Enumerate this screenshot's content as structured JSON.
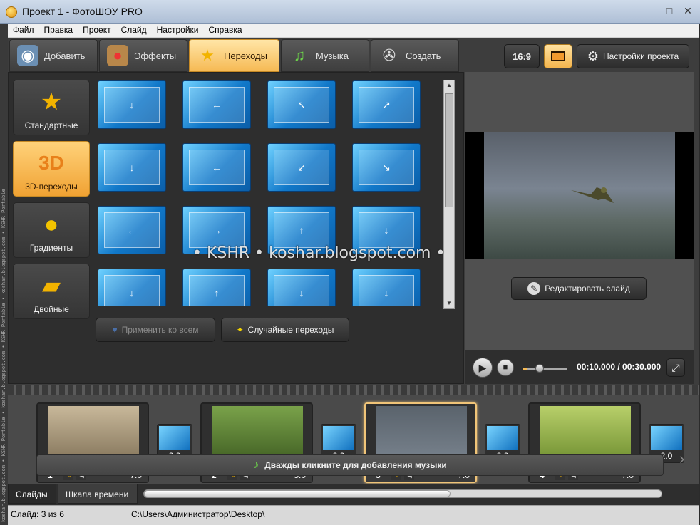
{
  "window": {
    "title": "Проект 1 - ФотоШОУ PRO",
    "controls": [
      "_",
      "□",
      "✕"
    ]
  },
  "menu": [
    "Файл",
    "Правка",
    "Проект",
    "Слайд",
    "Настройки",
    "Справка"
  ],
  "sideband_text": "koshar.blogspot.com • KSHR Portable • koshar.blogspot.com • KSHR Portable • koshar.blogspot.com • KSHR Portable",
  "tabs": [
    {
      "label": "Добавить",
      "icon": "camera-icon",
      "active": false
    },
    {
      "label": "Эффекты",
      "icon": "palette-icon",
      "active": false
    },
    {
      "label": "Переходы",
      "icon": "star-icon",
      "active": true
    },
    {
      "label": "Музыка",
      "icon": "music-note-icon",
      "active": false
    },
    {
      "label": "Создать",
      "icon": "film-reel-icon",
      "active": false
    }
  ],
  "categories": [
    {
      "label": "Стандартные",
      "icon": "star-icon",
      "active": false
    },
    {
      "label": "3D-переходы",
      "icon": "3d-icon",
      "active": true
    },
    {
      "label": "Градиенты",
      "icon": "gradient-icon",
      "active": false
    },
    {
      "label": "Двойные",
      "icon": "double-icon",
      "active": false
    }
  ],
  "transitions": [
    {
      "arrow": "↓"
    },
    {
      "arrow": "←"
    },
    {
      "arrow": "↖"
    },
    {
      "arrow": "↗"
    },
    {
      "arrow": "↓"
    },
    {
      "arrow": "←"
    },
    {
      "arrow": "↙"
    },
    {
      "arrow": "↘"
    },
    {
      "arrow": "←"
    },
    {
      "arrow": "→"
    },
    {
      "arrow": "↑"
    },
    {
      "arrow": "↓"
    },
    {
      "arrow": "↓"
    },
    {
      "arrow": "↑"
    },
    {
      "arrow": "↓"
    },
    {
      "arrow": "↓"
    }
  ],
  "buttons": {
    "apply_all": "Применить ко всем",
    "random": "Случайные переходы",
    "aspect": "16:9",
    "project_settings": "Настройки проекта",
    "edit_slide": "Редактировать слайд"
  },
  "player": {
    "time": "00:10.000 / 00:30.000",
    "progress": 0.1
  },
  "slides": [
    {
      "num": "1",
      "duration": "7.0",
      "active": false,
      "colors": [
        "#c8b89a",
        "#7e6f55"
      ]
    },
    {
      "num": "2",
      "duration": "5.0",
      "active": false,
      "colors": [
        "#7aa24a",
        "#3c5a20"
      ]
    },
    {
      "num": "3",
      "duration": "7.0",
      "active": true,
      "colors": [
        "#5a636c",
        "#7b8590"
      ]
    },
    {
      "num": "4",
      "duration": "7.0",
      "active": false,
      "colors": [
        "#b8cf6a",
        "#6a8a2c"
      ]
    }
  ],
  "slide_transitions": [
    "2.0",
    "2.0",
    "2.0",
    "2.0"
  ],
  "music_hint": "Дважды кликните для добавления музыки",
  "bottom_tabs": [
    {
      "label": "Слайды",
      "active": true
    },
    {
      "label": "Шкала времени",
      "active": false
    }
  ],
  "status": {
    "slide": "Слайд: 3 из 6",
    "path": "C:\\Users\\Администратор\\Desktop\\"
  },
  "watermark": "• KSHR • koshar.blogspot.com •",
  "colors": {
    "accent": "#f6ba54",
    "transition_blue": "#1178c9"
  }
}
